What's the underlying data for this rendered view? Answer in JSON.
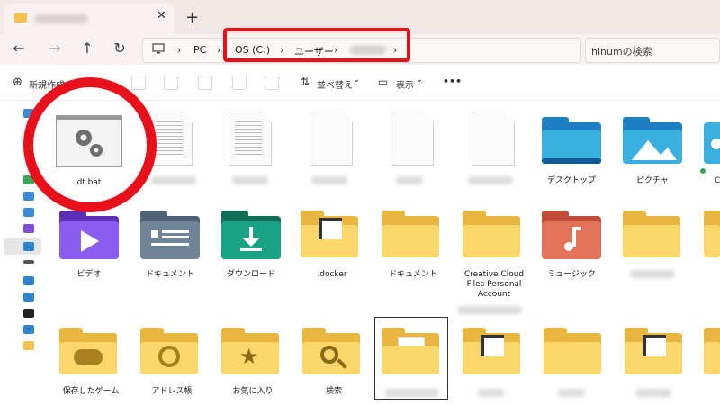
{
  "window": {
    "tab_close": "✕",
    "new_tab": "+"
  },
  "nav": {
    "back": "←",
    "forward": "→",
    "up": "↑",
    "refresh": "↻",
    "breadcrumb_sep": "›",
    "crumb_pc": "PC",
    "crumb_drive": "OS (C:)",
    "crumb_users": "ユーザー",
    "search_placeholder": "hinumの検索"
  },
  "toolbar": {
    "new_label": "新規作成",
    "sort_label": "並べ替え",
    "view_label": "表示",
    "more_label": "•••",
    "chevron": "⌄"
  },
  "files": {
    "row1": [
      {
        "label": "dt.bat",
        "kind": "bat"
      },
      {
        "label": "",
        "kind": "doc-lines"
      },
      {
        "label": "",
        "kind": "doc-lines"
      },
      {
        "label": "",
        "kind": "doc-blank"
      },
      {
        "label": "",
        "kind": "doc-blank"
      },
      {
        "label": "",
        "kind": "doc-blank"
      },
      {
        "label": "デスクトップ",
        "kind": "folder-desktop"
      },
      {
        "label": "ピクチャ",
        "kind": "folder-pictures"
      },
      {
        "label": "C",
        "kind": "folder-cloud"
      }
    ],
    "row2": [
      {
        "label": "ビデオ",
        "kind": "folder-video"
      },
      {
        "label": "ドキュメント",
        "kind": "folder-docs"
      },
      {
        "label": "ダウンロード",
        "kind": "folder-download"
      },
      {
        "label": ".docker",
        "kind": "folder-shortcut"
      },
      {
        "label": "ドキュメント",
        "kind": "folder"
      },
      {
        "label": "Creative Cloud Files Personal Account",
        "kind": "folder"
      },
      {
        "label": "ミュージック",
        "kind": "folder-music"
      },
      {
        "label": "",
        "kind": "folder"
      },
      {
        "label": "",
        "kind": "folder"
      }
    ],
    "row3": [
      {
        "label": "保存したゲーム",
        "kind": "folder-games"
      },
      {
        "label": "アドレス帳",
        "kind": "folder-contacts"
      },
      {
        "label": "お気に入り",
        "kind": "folder-favorites"
      },
      {
        "label": "検索",
        "kind": "folder-search"
      },
      {
        "label": "",
        "kind": "folder-file"
      },
      {
        "label": "",
        "kind": "folder-shortcut"
      },
      {
        "label": "",
        "kind": "folder"
      },
      {
        "label": "",
        "kind": "folder-shortcut"
      },
      {
        "label": "",
        "kind": "folder"
      }
    ]
  },
  "colors": {
    "highlight_red": "#e8101a",
    "folder_yellow": "#fbd66a"
  }
}
